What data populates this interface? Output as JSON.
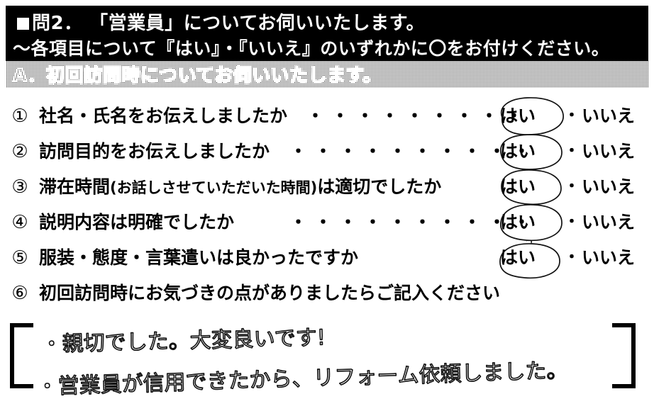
{
  "header": {
    "bullet_icon": "filled-square",
    "line1": "問2． 「営業員」についてお伺いいたします。",
    "line2": "～各項目について『はい』・『いいえ』のいずれかに〇をお付けください。",
    "section_label": "A．初回訪問時についてお伺いいたします。"
  },
  "questions": [
    {
      "number": "①",
      "text": "社名・氏名をお伝えしましたか",
      "sub": "",
      "leader_dots": "・・・・・・・・・",
      "has_leader": true,
      "yes_label": "はい",
      "separator": "・",
      "no_label": "いいえ",
      "selected": "はい",
      "circled": true
    },
    {
      "number": "②",
      "text": "訪問目的をお伝えしましたか",
      "sub": "",
      "leader_dots": "・・・・・・・・・・",
      "has_leader": true,
      "yes_label": "はい",
      "separator": "・",
      "no_label": "いいえ",
      "selected": "はい",
      "circled": true
    },
    {
      "number": "③",
      "text": "滞在時間",
      "sub": "(お話しさせていただいた時間)",
      "text_tail": "は適切でしたか",
      "leader_dots": "",
      "has_leader": false,
      "yes_label": "はい",
      "separator": "・",
      "no_label": "いいえ",
      "selected": "はい",
      "circled": true
    },
    {
      "number": "④",
      "text": "説明内容は明確でしたか",
      "sub": "",
      "leader_dots": "・・・・・・・・・・",
      "has_leader": true,
      "yes_label": "はい",
      "separator": "・",
      "no_label": "いいえ",
      "selected": "はい",
      "circled": true
    },
    {
      "number": "⑤",
      "text": "服装・態度・言葉遣いは良かったですか",
      "sub": "",
      "leader_dots": "",
      "has_leader": false,
      "yes_label": "はい",
      "separator": "・",
      "no_label": "いいえ",
      "selected": "はい",
      "circled": true
    },
    {
      "number": "⑥",
      "text": "初回訪問時にお気づきの点がありましたらご記入ください",
      "sub": "",
      "leader_dots": "",
      "has_leader": false,
      "yes_label": "",
      "separator": "",
      "no_label": "",
      "selected": "",
      "circled": false
    }
  ],
  "handwritten_answer": {
    "bracket_left": "[",
    "bracket_right": "]",
    "line1": "・親切でした。大変良いです!",
    "line2": "・営業員が信用できたから、リフォーム依頼しました。"
  },
  "colors": {
    "ink": "#000000",
    "paper": "#ffffff",
    "header_band": "#000000",
    "header_text": "#ffffff",
    "section_band_pattern": "#808080"
  }
}
